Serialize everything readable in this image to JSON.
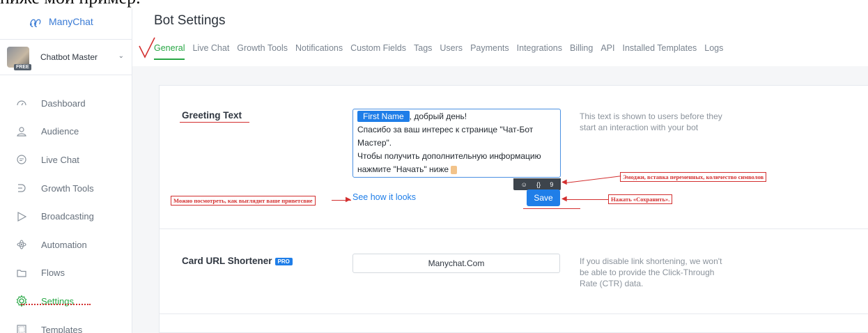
{
  "top_cut_text": "ниже мой пример.",
  "brand": {
    "name": "ManyChat"
  },
  "account": {
    "name": "Chatbot Master",
    "badge": "FREE"
  },
  "nav": [
    {
      "label": "Dashboard",
      "icon": "dashboard-icon"
    },
    {
      "label": "Audience",
      "icon": "audience-icon"
    },
    {
      "label": "Live Chat",
      "icon": "chat-icon"
    },
    {
      "label": "Growth Tools",
      "icon": "growth-icon"
    },
    {
      "label": "Broadcasting",
      "icon": "broadcast-icon"
    },
    {
      "label": "Automation",
      "icon": "automation-icon"
    },
    {
      "label": "Flows",
      "icon": "folder-icon"
    },
    {
      "label": "Settings",
      "icon": "gear-icon",
      "active": true
    },
    {
      "label": "Templates",
      "icon": "templates-icon"
    }
  ],
  "page": {
    "title": "Bot Settings"
  },
  "tabs": [
    "General",
    "Live Chat",
    "Growth Tools",
    "Notifications",
    "Custom Fields",
    "Tags",
    "Users",
    "Payments",
    "Integrations",
    "Billing",
    "API",
    "Installed Templates",
    "Logs"
  ],
  "greeting": {
    "label": "Greeting Text",
    "chip": "First Name",
    "line1_rest": ", добрый день!",
    "line2": "Спасибо за ваш интерес к странице \"Чат-Бот",
    "line3": "Мастер\".",
    "line4": "Чтобы получить дополнительную информацию",
    "line5": "нажмите \"Начать\" ниже",
    "char_count": "9",
    "help1": "This text is shown to users before they",
    "help2": "start an interaction with your bot",
    "see_link": "See how it looks",
    "save_label": "Save"
  },
  "annotations": {
    "emoji": "Эмоджи, вставка переменных, количество символов",
    "preview": "Можно посмотреть, как выглядит ваше приветсвие",
    "save": "Нажать «Сохранить»."
  },
  "url_shortener": {
    "label": "Card URL Shortener",
    "pro": "PRO",
    "value": "Manychat.Com",
    "help1": "If you disable link shortening, we won't",
    "help2": "be able to provide the Click-Through",
    "help3": "Rate (CTR) data."
  },
  "colors": {
    "accent_green": "#28a745",
    "accent_blue": "#1f7ee8",
    "annotation_red": "#d32f2f"
  }
}
